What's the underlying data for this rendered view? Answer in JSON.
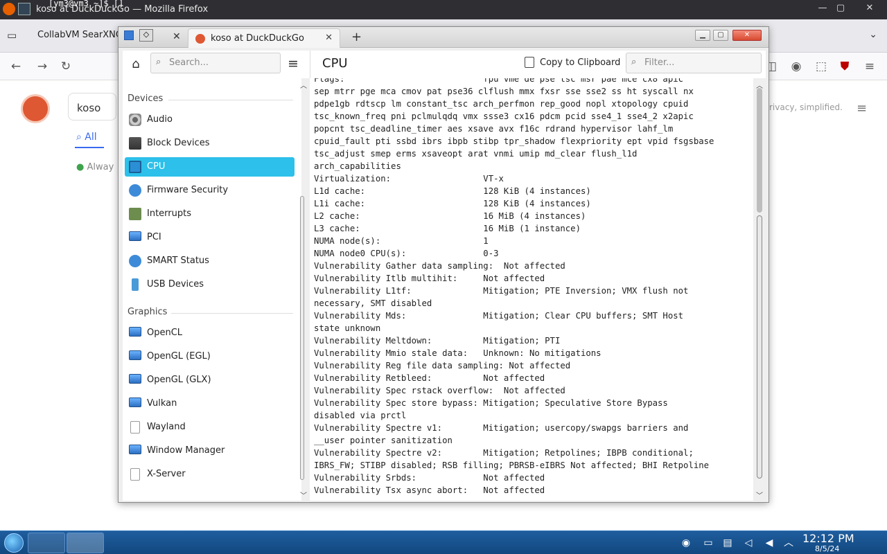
{
  "os_titlebar": {
    "title": "koso at DuckDuckGo — Mozilla Firefox",
    "terminal_text": "[ym3@vm3 ~]$ []",
    "min": "—",
    "max": "▢",
    "close": "✕"
  },
  "firefox": {
    "tab_label": "CollabVM SearXNG",
    "ddg": {
      "query": "koso",
      "tab_all": "All",
      "always_text": "Alway",
      "slogan": "rivacy, simplified."
    }
  },
  "window": {
    "tab_label": "koso at DuckDuckGo",
    "toolbar": {
      "search_placeholder": "Search...",
      "heading": "CPU",
      "copy_label": "Copy to Clipboard",
      "filter_placeholder": "Filter..."
    }
  },
  "sidebar": {
    "sections": [
      {
        "label": "Devices"
      },
      {
        "label": "Graphics"
      }
    ],
    "devices": [
      {
        "label": "Audio",
        "icon": "speaker-icon"
      },
      {
        "label": "Block Devices",
        "icon": "disk-icon"
      },
      {
        "label": "CPU",
        "icon": "chip-icon",
        "selected": true
      },
      {
        "label": "Firmware Security",
        "icon": "shield-icon"
      },
      {
        "label": "Interrupts",
        "icon": "board-icon"
      },
      {
        "label": "PCI",
        "icon": "monitor-icon"
      },
      {
        "label": "SMART Status",
        "icon": "shield-icon"
      },
      {
        "label": "USB Devices",
        "icon": "usb-icon"
      }
    ],
    "graphics": [
      {
        "label": "OpenCL",
        "icon": "monitor-icon"
      },
      {
        "label": "OpenGL (EGL)",
        "icon": "monitor-icon"
      },
      {
        "label": "OpenGL (GLX)",
        "icon": "monitor-icon"
      },
      {
        "label": "Vulkan",
        "icon": "monitor-icon"
      },
      {
        "label": "Wayland",
        "icon": "page-icon"
      },
      {
        "label": "Window Manager",
        "icon": "monitor-icon"
      },
      {
        "label": "X-Server",
        "icon": "page-icon"
      }
    ]
  },
  "cpu_info": {
    "lines": [
      "Flags:                           fpu vme de pse tsc msr pae mce cx8 apic",
      "sep mtrr pge mca cmov pat pse36 clflush mmx fxsr sse sse2 ss ht syscall nx",
      "pdpe1gb rdtscp lm constant_tsc arch_perfmon rep_good nopl xtopology cpuid",
      "tsc_known_freq pni pclmulqdq vmx ssse3 cx16 pdcm pcid sse4_1 sse4_2 x2apic",
      "popcnt tsc_deadline_timer aes xsave avx f16c rdrand hypervisor lahf_lm",
      "cpuid_fault pti ssbd ibrs ibpb stibp tpr_shadow flexpriority ept vpid fsgsbase",
      "tsc_adjust smep erms xsaveopt arat vnmi umip md_clear flush_l1d",
      "arch_capabilities",
      "Virtualization:                  VT-x",
      "L1d cache:                       128 KiB (4 instances)",
      "L1i cache:                       128 KiB (4 instances)",
      "L2 cache:                        16 MiB (4 instances)",
      "L3 cache:                        16 MiB (1 instance)",
      "NUMA node(s):                    1",
      "NUMA node0 CPU(s):               0-3",
      "Vulnerability Gather data sampling:  Not affected",
      "Vulnerability Itlb multihit:     Not affected",
      "Vulnerability L1tf:              Mitigation; PTE Inversion; VMX flush not",
      "necessary, SMT disabled",
      "Vulnerability Mds:               Mitigation; Clear CPU buffers; SMT Host",
      "state unknown",
      "Vulnerability Meltdown:          Mitigation; PTI",
      "Vulnerability Mmio stale data:   Unknown: No mitigations",
      "Vulnerability Reg file data sampling: Not affected",
      "Vulnerability Retbleed:          Not affected",
      "Vulnerability Spec rstack overflow:  Not affected",
      "Vulnerability Spec store bypass: Mitigation; Speculative Store Bypass",
      "disabled via prctl",
      "Vulnerability Spectre v1:        Mitigation; usercopy/swapgs barriers and",
      "__user pointer sanitization",
      "Vulnerability Spectre v2:        Mitigation; Retpolines; IBPB conditional;",
      "IBRS_FW; STIBP disabled; RSB filling; PBRSB-eIBRS Not affected; BHI Retpoline",
      "Vulnerability Srbds:             Not affected",
      "Vulnerability Tsx async abort:   Not affected"
    ]
  },
  "taskbar": {
    "time": "12:12 PM",
    "date": "8/5/24"
  }
}
